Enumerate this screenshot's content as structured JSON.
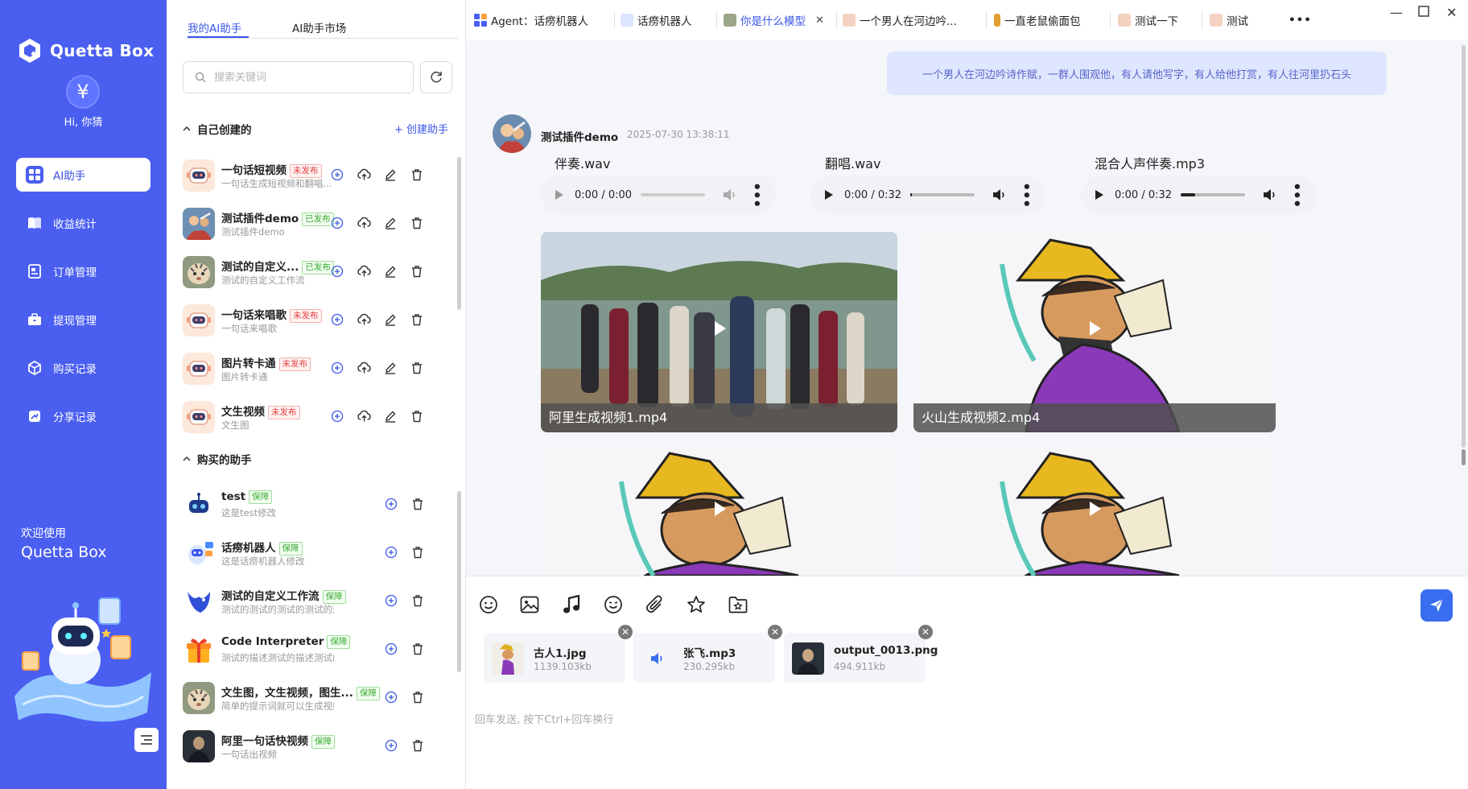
{
  "app": {
    "name": "Quetta Box",
    "greeting": "Hi, 你猜",
    "avatar_glyph": "¥"
  },
  "nav": {
    "items": [
      {
        "label": "AI助手",
        "icon": "grid-icon",
        "active": true
      },
      {
        "label": "收益统计",
        "icon": "book-icon"
      },
      {
        "label": "订单管理",
        "icon": "document-icon"
      },
      {
        "label": "提现管理",
        "icon": "briefcase-icon"
      },
      {
        "label": "购买记录",
        "icon": "cube-icon"
      },
      {
        "label": "分享记录",
        "icon": "share-icon"
      }
    ],
    "welcome_line1": "欢迎使用",
    "welcome_line2": "Quetta Box"
  },
  "mid": {
    "tabs": [
      "我的AI助手",
      "AI助手市场"
    ],
    "search_placeholder": "搜索关键词",
    "section_created": "自己创建的",
    "create_label": "+ 创建助手",
    "section_bought": "购买的助手",
    "created": [
      {
        "name": "一句话短视频",
        "badge": "未发布",
        "kind": "unpub",
        "desc": "一句话生成短视频和翻唱...",
        "avatar": "robot"
      },
      {
        "name": "测试插件demo",
        "badge": "已发布",
        "kind": "pub",
        "desc": "测试插件demo",
        "avatar": "fight"
      },
      {
        "name": "测试的自定义...",
        "badge": "已发布",
        "kind": "pub",
        "desc": "测试的自定义工作流",
        "avatar": "tiger"
      },
      {
        "name": "一句话来唱歌",
        "badge": "未发布",
        "kind": "unpub",
        "desc": "一句话来唱歌",
        "avatar": "robot"
      },
      {
        "name": "图片转卡通",
        "badge": "未发布",
        "kind": "unpub",
        "desc": "图片转卡通",
        "avatar": "robot"
      },
      {
        "name": "文生视频",
        "badge": "未发布",
        "kind": "unpub",
        "desc": "文生图",
        "avatar": "robot"
      }
    ],
    "bought": [
      {
        "name": "test",
        "badge": "保障",
        "desc": "这是test修改",
        "avatar": "bluebot"
      },
      {
        "name": "话痨机器人",
        "badge": "保障",
        "desc": "这是话痨机器人修改",
        "avatar": "chatbot"
      },
      {
        "name": "测试的自定义工作流",
        "badge": "保障",
        "desc": "测试的测试的测试的测试的测...",
        "avatar": "bird"
      },
      {
        "name": "Code Interpreter",
        "badge": "保障",
        "desc": "测试的描述测试的描述测试的描述...",
        "avatar": "gift"
      },
      {
        "name": "文生图，文生视频，图生...",
        "badge": "保障",
        "desc": "简单的提示词就可以生成视频",
        "avatar": "tiger"
      },
      {
        "name": "阿里一句话快视频",
        "badge": "保障",
        "desc": "一句话出视频",
        "avatar": "dark"
      }
    ]
  },
  "chat_tabs": [
    {
      "label": "Agent：话痨机器人"
    },
    {
      "label": "话痨机器人"
    },
    {
      "label": "你是什么模型",
      "active": true
    },
    {
      "label": "一个男人在河边吟..."
    },
    {
      "label": "一直老鼠偷面包"
    },
    {
      "label": "测试一下"
    },
    {
      "label": "测试"
    }
  ],
  "chat": {
    "user_message": "一个男人在河边吟诗作赋，一群人围观他，有人请他写字，有人给他打赏，有人往河里扔石头",
    "bot_name": "测试插件demo",
    "bot_time": "2025-07-30 13:38:11",
    "audios": [
      {
        "title": "伴奏.wav",
        "time": "0:00 / 0:00",
        "progress": 0
      },
      {
        "title": "翻唱.wav",
        "time": "0:00 / 0:32",
        "progress": 0.02
      },
      {
        "title": "混合人声伴奏.mp3",
        "time": "0:00 / 0:32",
        "progress": 0.22
      }
    ],
    "videos": [
      {
        "caption": "阿里生成视频1.mp4"
      },
      {
        "caption": "火山生成视频2.mp4"
      }
    ]
  },
  "composer": {
    "attachments": [
      {
        "name": "古人1.jpg",
        "size": "1139.103kb"
      },
      {
        "name": "张飞.mp3",
        "size": "230.295kb"
      },
      {
        "name": "output_0013.png",
        "size": "494.911kb"
      }
    ],
    "hint": "回车发送, 按下Ctrl+回车换行"
  },
  "colors": {
    "brand": "#4a5ef0",
    "accent": "#3a56e8",
    "send": "#3a6ef0"
  }
}
